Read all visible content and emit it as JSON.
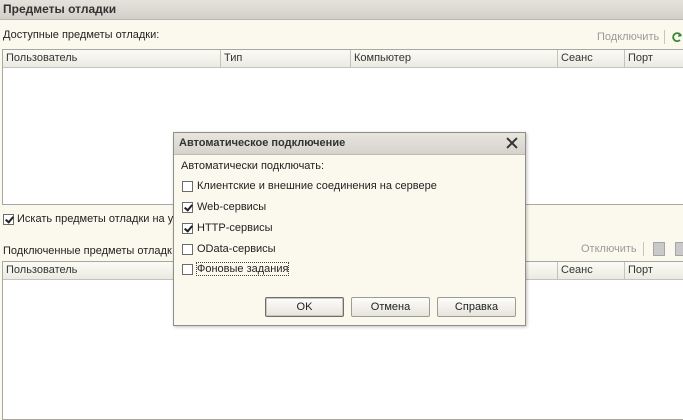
{
  "window": {
    "title": "Предметы отладки"
  },
  "available": {
    "label": "Доступные предметы отладки:",
    "connect_action": "Подключить",
    "columns": [
      "Пользователь",
      "Тип",
      "Компьютер",
      "Сеанс",
      "Порт"
    ]
  },
  "search_checkbox": {
    "label": "Искать предметы отладки на у",
    "checked": true
  },
  "connected": {
    "label": "Подключенные предметы отладк",
    "disconnect_action": "Отключить",
    "columns": [
      "Пользователь",
      "Сеанс",
      "Порт"
    ]
  },
  "dialog": {
    "title": "Автоматическое подключение",
    "prompt": "Автоматически подключать:",
    "options": [
      {
        "label": "Клиентские и внешние соединения на сервере",
        "checked": false
      },
      {
        "label": "Web-сервисы",
        "checked": true
      },
      {
        "label": "HTTP-сервисы",
        "checked": true
      },
      {
        "label": "OData-сервисы",
        "checked": false
      },
      {
        "label": "Фоновые задания",
        "checked": false
      }
    ],
    "buttons": {
      "ok": "OK",
      "cancel": "Отмена",
      "help": "Справка"
    }
  },
  "colors": {
    "background": "#fbf9ee",
    "disabled_link": "#9a9a9a",
    "refresh_icon": "#3a8a3a"
  }
}
